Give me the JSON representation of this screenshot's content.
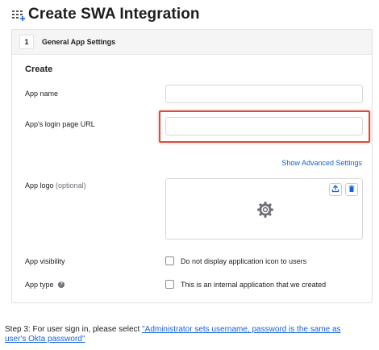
{
  "page": {
    "title": "Create SWA Integration",
    "title_icon": "grid-plus-icon"
  },
  "card": {
    "step_number": "1",
    "step_label": "General App Settings",
    "section_heading": "Create",
    "fields": {
      "app_name": {
        "label": "App name",
        "value": ""
      },
      "login_url": {
        "label": "App's login page URL",
        "value": ""
      },
      "app_logo": {
        "label": "App logo",
        "optional": "(optional)"
      },
      "app_visibility": {
        "label": "App visibility",
        "checkbox_label": "Do not display application icon to users",
        "checked": false
      },
      "app_type": {
        "label": "App type",
        "checkbox_label": "This is an internal application that we created",
        "checked": false
      }
    },
    "advanced_link": "Show Advanced Settings",
    "icons": {
      "upload": "upload-icon",
      "delete": "trash-icon",
      "logo_placeholder": "gear-icon",
      "help": "help-icon"
    }
  },
  "colors": {
    "accent": "#1662dd",
    "highlight": "#d9503a"
  },
  "instruction": {
    "prefix": "Step 3: For user sign in, please select ",
    "link_text": "\"Administrator sets username, password is the same as user's Okta password\""
  }
}
